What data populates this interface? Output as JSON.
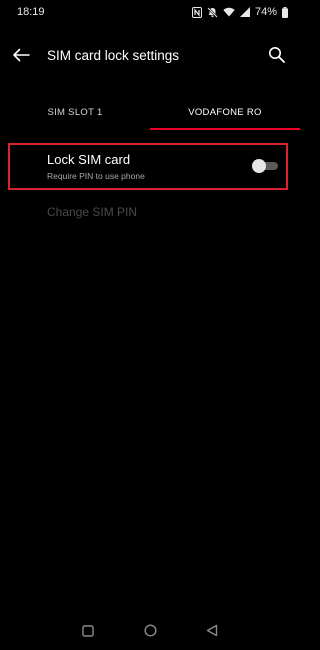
{
  "status_bar": {
    "time": "18:19",
    "battery": "74%",
    "icons": [
      "nfc-icon",
      "mute-icon",
      "wifi-icon",
      "signal-icon",
      "battery-icon"
    ]
  },
  "app_bar": {
    "title": "SIM card lock settings",
    "back_icon": "arrow-left-icon",
    "search_icon": "search-icon"
  },
  "tabs": [
    {
      "label": "SIM SLOT 1",
      "active": false
    },
    {
      "label": "VODAFONE RO",
      "active": true
    }
  ],
  "settings": {
    "lock_sim": {
      "title": "Lock SIM card",
      "subtitle": "Require PIN to use phone",
      "enabled": false
    },
    "change_pin": {
      "label": "Change SIM PIN",
      "disabled": true
    }
  },
  "nav_bar": {
    "icons": [
      "recents-icon",
      "home-icon",
      "back-icon"
    ]
  },
  "colors": {
    "background": "#000000",
    "accent": "#eb0028",
    "highlight_border": "#d9242f",
    "disabled_text": "#4a4a4a"
  }
}
